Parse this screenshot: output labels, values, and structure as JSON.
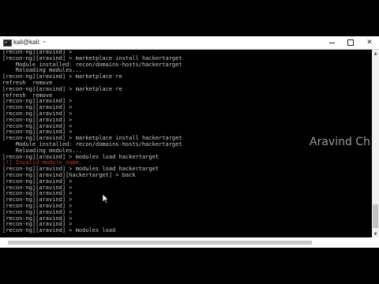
{
  "window": {
    "title": "kali@kali: ~",
    "controls": {
      "minimize": "minimize",
      "maximize": "maximize",
      "close": "✕"
    }
  },
  "terminal": {
    "lines": [
      {
        "text": "[recon-ng][aravind] >",
        "color": "default"
      },
      {
        "text": "[recon-ng][aravind] > marketplace install hackertarget",
        "color": "default"
      },
      {
        "text": "    Module installed: recon/domains-hosts/hackertarget",
        "color": "default"
      },
      {
        "text": "    Reloading modules...",
        "color": "default"
      },
      {
        "text": "[recon-ng][aravind] > marketplace re",
        "color": "default"
      },
      {
        "text": "refresh  remove",
        "color": "default"
      },
      {
        "text": "[recon-ng][aravind] > marketplace re",
        "color": "default"
      },
      {
        "text": "refresh  remove",
        "color": "default"
      },
      {
        "text": "[recon-ng][aravind] >",
        "color": "default"
      },
      {
        "text": "[recon-ng][aravind] >",
        "color": "default"
      },
      {
        "text": "[recon-ng][aravind] >",
        "color": "default"
      },
      {
        "text": "[recon-ng][aravind] >",
        "color": "default"
      },
      {
        "text": "[recon-ng][aravind] >",
        "color": "default"
      },
      {
        "text": "[recon-ng][aravind] >",
        "color": "default"
      },
      {
        "text": "[recon-ng][aravind] > marketplace install hackertarget",
        "color": "default"
      },
      {
        "text": "    Module installed: recon/domains-hosts/hackertarget",
        "color": "default"
      },
      {
        "text": "    Reloading modules...",
        "color": "default"
      },
      {
        "text": "[recon-ng][aravind] > modules load hackertarget",
        "color": "default"
      },
      {
        "text": "[!] Invalid module name.",
        "color": "red"
      },
      {
        "text": "[recon-ng][aravind] > modules load hackertarget",
        "color": "default"
      },
      {
        "text": "[recon-ng][aravind][hackertarget] > back",
        "color": "default"
      },
      {
        "text": "[recon-ng][aravind] >",
        "color": "default"
      },
      {
        "text": "[recon-ng][aravind] >",
        "color": "default"
      },
      {
        "text": "[recon-ng][aravind] >",
        "color": "default"
      },
      {
        "text": "[recon-ng][aravind] >",
        "color": "default"
      },
      {
        "text": "[recon-ng][aravind] >",
        "color": "default"
      },
      {
        "text": "[recon-ng][aravind] >",
        "color": "default"
      },
      {
        "text": "[recon-ng][aravind] >",
        "color": "default"
      },
      {
        "text": "[recon-ng][aravind] >",
        "color": "default"
      },
      {
        "text": "[recon-ng][aravind] > modules load",
        "color": "default"
      }
    ]
  },
  "watermark": "Aravind Ch",
  "colors": {
    "background": "#000000",
    "text": "#c8c8c8",
    "error": "#c0392b"
  }
}
